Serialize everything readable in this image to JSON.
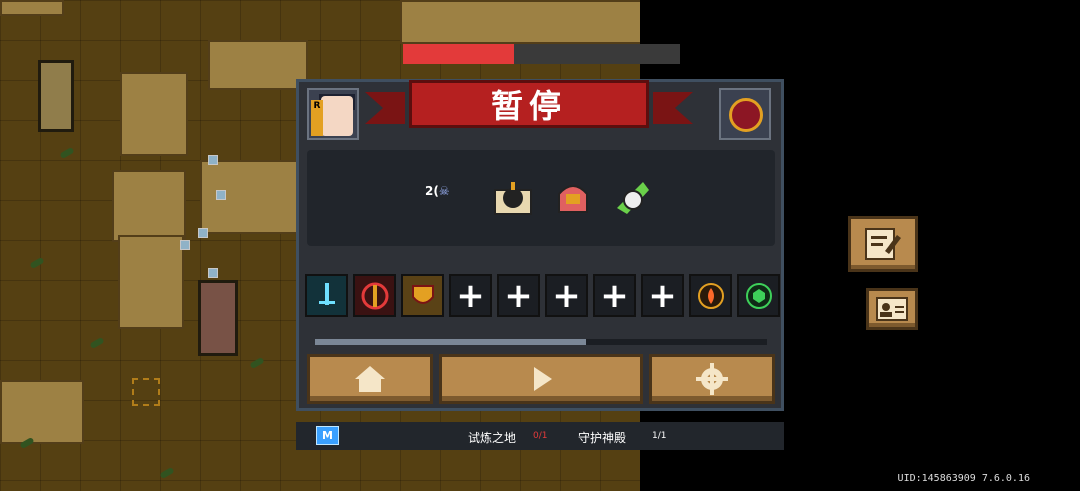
{
  "pause_menu": {
    "title": "暂停",
    "character_tag": "R",
    "buff_label": "2(",
    "equipment_slot_plus": "+",
    "stage_progress": 0.6
  },
  "enemy": {
    "health_fraction": 0.4
  },
  "bottom_bar": {
    "mode_badge": "M",
    "quest_1": "试炼之地",
    "quest_1_count": "0/1",
    "quest_2": "守护神殿",
    "quest_2_count": "1/1"
  },
  "footer": {
    "uid": "UID:145863909 7.6.0.16"
  },
  "colors": {
    "banner": "#b52020",
    "button": "#b88a4e",
    "panel": "#2e3137"
  }
}
